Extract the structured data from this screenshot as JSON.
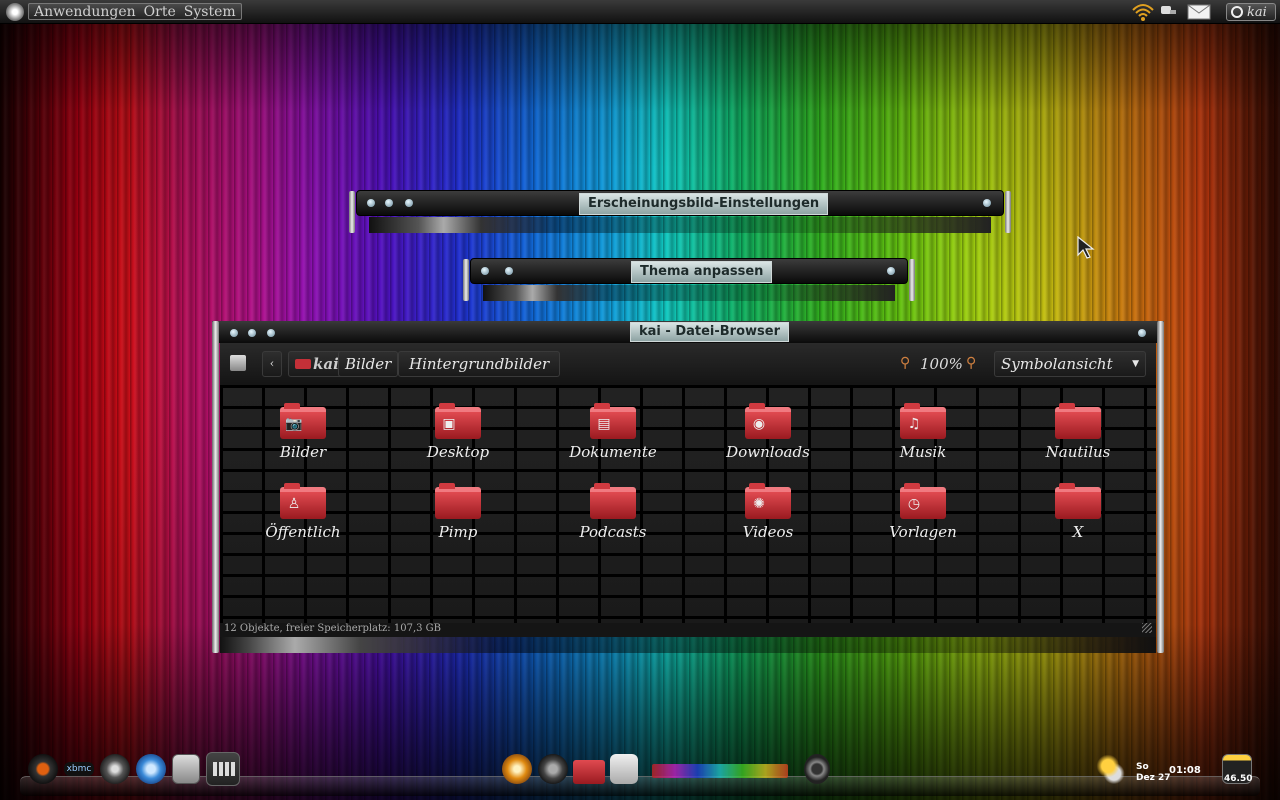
{
  "top_panel": {
    "menus": [
      "Anwendungen",
      "Orte",
      "System"
    ],
    "user": "kai",
    "icons": [
      "ubuntu-logo-icon",
      "wifi-icon",
      "chat-icon",
      "mail-icon",
      "power-icon"
    ]
  },
  "windows": {
    "appearance": {
      "title": "Erscheinungsbild-Einstellungen"
    },
    "theme": {
      "title": "Thema anpassen"
    },
    "file_browser": {
      "title": "kai - Datei-Browser",
      "breadcrumbs": [
        "kai",
        "Bilder",
        "Hintergrundbilder"
      ],
      "zoom": "100%",
      "view_mode": "Symbolansicht",
      "items": [
        {
          "label": "Bilder",
          "emblem": "camera"
        },
        {
          "label": "Desktop",
          "emblem": "desktop"
        },
        {
          "label": "Dokumente",
          "emblem": "documents"
        },
        {
          "label": "Downloads",
          "emblem": "download"
        },
        {
          "label": "Musik",
          "emblem": "music"
        },
        {
          "label": "Nautilus",
          "emblem": ""
        },
        {
          "label": "Öffentlich",
          "emblem": "person"
        },
        {
          "label": "Pimp",
          "emblem": ""
        },
        {
          "label": "Podcasts",
          "emblem": ""
        },
        {
          "label": "Videos",
          "emblem": "film"
        },
        {
          "label": "Vorlagen",
          "emblem": "clock"
        },
        {
          "label": "X",
          "emblem": ""
        }
      ],
      "status": "12 Objekte, freier Speicherplatz: 107,3 GB"
    }
  },
  "dock": {
    "left_icons": [
      "firefox-icon",
      "xbmc-icon",
      "ubuntu-tweak-icon",
      "chrome-icon",
      "file-cabinet-icon",
      "calendar-icon"
    ],
    "center_icons": [
      "gimp-icon",
      "ubuntu-icon",
      "folder-icon",
      "terminal-icon",
      "music-visualizer-icon",
      "speaker-icon"
    ],
    "weather_icon": "weather-partly-cloudy-icon",
    "clock": {
      "day": "So",
      "date": "Dez 27",
      "time": "01:08"
    },
    "battery": "46.50"
  },
  "colors": {
    "accent_red": "#d03a40",
    "title_tab": "#b8c8c8"
  }
}
